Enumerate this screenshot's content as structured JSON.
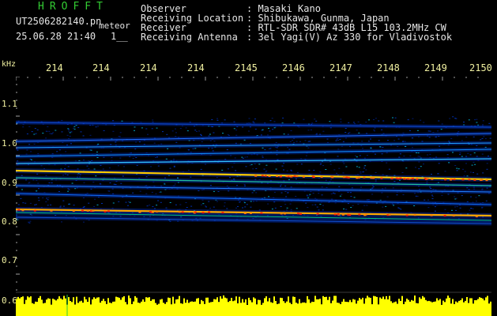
{
  "header": {
    "app_title": "HROFFT",
    "filename": "UT2506282140.pn",
    "filename_suffix": "meteor",
    "datetime": "25.06.28 21:40",
    "counter": "1__"
  },
  "station_info": [
    {
      "label": "Observer",
      "value": ": Masaki Kano"
    },
    {
      "label": "Receiving Location",
      "value": ": Shibukawa, Gunma, Japan"
    },
    {
      "label": "Receiver",
      "value": ": RTL-SDR SDR# 43dB L15 103.2MHz CW"
    },
    {
      "label": "Receiving Antenna",
      "value": ": 3el Yagi(V) Az 330 for Vladivostok"
    }
  ],
  "axes": {
    "y_unit": "kHz",
    "x_ticks": [
      "214",
      "214",
      "214",
      "214",
      "2145",
      "2146",
      "2147",
      "2148",
      "2149",
      "2150"
    ],
    "y_ticks": [
      "1.1",
      "1.0",
      "0.9",
      "0.8",
      "0.7",
      "0.6"
    ]
  },
  "colors": {
    "background": "#000000",
    "text": "#e6e6e6",
    "title": "#33cc33",
    "axis": "#f0f0a0",
    "amplitude": "#ffff00"
  }
}
